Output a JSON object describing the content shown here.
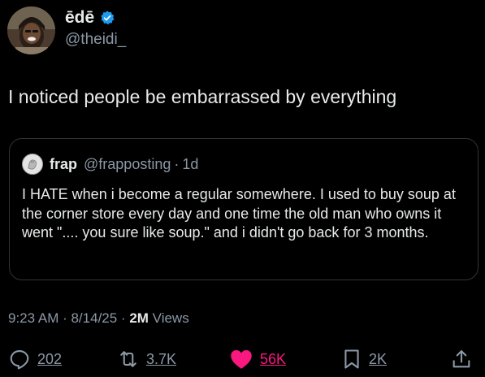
{
  "author": {
    "display_name": "ēdē",
    "handle": "@theidi_",
    "verified": true
  },
  "tweet": {
    "text": "I noticed people be embarrassed by everything"
  },
  "quote": {
    "display_name": "frap",
    "handle": "@frapposting",
    "separator": "·",
    "time": "1d",
    "text": "I HATE when i become a regular somewhere. I used to buy soup at the corner store every day and one time the old man who owns it went \".... you sure like soup.\" and i didn't go back for 3 months."
  },
  "meta": {
    "timestamp": "9:23 AM · 8/14/25 · ",
    "views_count": "2M",
    "views_label": " Views"
  },
  "actions": {
    "replies": "202",
    "reposts": "3.7K",
    "likes": "56K",
    "bookmarks": "2K"
  },
  "colors": {
    "background": "#000000",
    "text": "#e7e9ea",
    "secondary": "#8b98a5",
    "verified": "#1d9bf0",
    "like": "#f91880",
    "border": "#2f3336"
  },
  "icons": {
    "verified": "verified-badge-icon",
    "reply": "reply-bubble-icon",
    "repost": "repost-arrows-icon",
    "like": "heart-icon",
    "bookmark": "bookmark-icon",
    "share": "share-icon"
  }
}
